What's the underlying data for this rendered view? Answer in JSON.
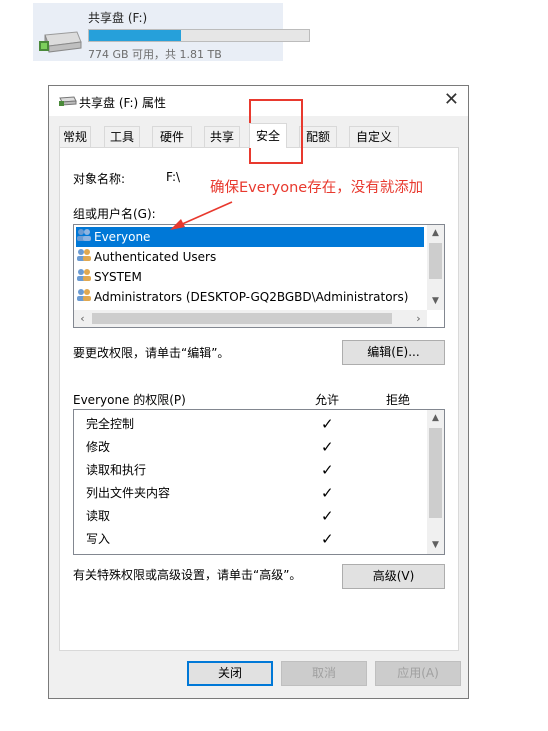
{
  "drive": {
    "name": "共享盘 (F:)",
    "usage_percent": 42,
    "info": "774 GB 可用，共 1.81 TB"
  },
  "dialog": {
    "title": "共享盘 (F:) 属性",
    "close": "✕"
  },
  "tabs": [
    "常规",
    "工具",
    "硬件",
    "共享",
    "安全",
    "配额",
    "自定义"
  ],
  "active_tab": "安全",
  "security": {
    "object_label": "对象名称:",
    "object_value": "F:\\",
    "groups_label": "组或用户名(G):",
    "users": [
      "Everyone",
      "Authenticated Users",
      "SYSTEM",
      "Administrators (DESKTOP-GQ2BGBD\\Administrators)"
    ],
    "selected_user": "Everyone",
    "edit_hint": "要更改权限，请单击“编辑”。",
    "edit_button": "编辑(E)...",
    "permissions_label": "Everyone 的权限(P)",
    "allow_header": "允许",
    "deny_header": "拒绝",
    "permissions": [
      {
        "name": "完全控制",
        "allow": "✓"
      },
      {
        "name": "修改",
        "allow": "✓"
      },
      {
        "name": "读取和执行",
        "allow": "✓"
      },
      {
        "name": "列出文件夹内容",
        "allow": "✓"
      },
      {
        "name": "读取",
        "allow": "✓"
      },
      {
        "name": "写入",
        "allow": "✓"
      }
    ],
    "advanced_hint": "有关特殊权限或高级设置，请单击“高级”。",
    "advanced_button": "高级(V)"
  },
  "annotation": "确保Everyone存在，没有就添加",
  "footer": {
    "ok": "关闭",
    "cancel": "取消",
    "apply": "应用(A)"
  },
  "colors": {
    "accent": "#0078d7",
    "annotation": "#e8392e",
    "drive_bar": "#26a0da"
  }
}
